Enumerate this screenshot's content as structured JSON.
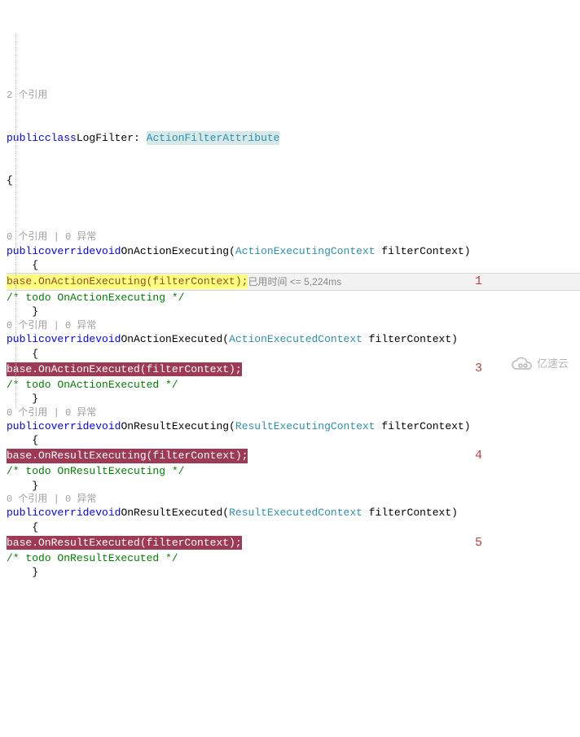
{
  "class_codelens": "2 个引用",
  "class_decl": {
    "kw_public": "public",
    "kw_class": "class",
    "name": "LogFilter",
    "base": "ActionFilterAttribute"
  },
  "braces": {
    "open": "{",
    "close": "}"
  },
  "method_codelens": "0 个引用 | 0 异常",
  "methods": [
    {
      "kw_public": "public",
      "kw_override": "override",
      "kw_void": "void",
      "name": "OnActionExecuting",
      "param_type": "ActionExecutingContext",
      "param_name": "filterContext",
      "call": "base.OnActionExecuting(filterContext);",
      "call_style": "hl-yellow",
      "comment": "/* todo OnActionExecuting */",
      "annotation": "1",
      "debug_tip": "已用时间 <= 5,224ms"
    },
    {
      "kw_public": "public",
      "kw_override": "override",
      "kw_void": "void",
      "name": "OnActionExecuted",
      "param_type": "ActionExecutedContext",
      "param_name": "filterContext",
      "call": "base.OnActionExecuted(filterContext);",
      "call_style": "hl-red",
      "comment": "/* todo OnActionExecuted */",
      "annotation": "3",
      "debug_tip": ""
    },
    {
      "kw_public": "public",
      "kw_override": "override",
      "kw_void": "void",
      "name": "OnResultExecuting",
      "param_type": "ResultExecutingContext",
      "param_name": "filterContext",
      "call": "base.OnResultExecuting(filterContext);",
      "call_style": "hl-red",
      "comment": "/* todo OnResultExecuting */",
      "annotation": "4",
      "debug_tip": ""
    },
    {
      "kw_public": "public",
      "kw_override": "override",
      "kw_void": "void",
      "name": "OnResultExecuted",
      "param_type": "ResultExecutedContext",
      "param_name": "filterContext",
      "call": "base.OnResultExecuted(filterContext);",
      "call_style": "hl-red",
      "comment": "/* todo OnResultExecuted */",
      "annotation": "5",
      "debug_tip": ""
    }
  ],
  "watermark": "亿速云"
}
